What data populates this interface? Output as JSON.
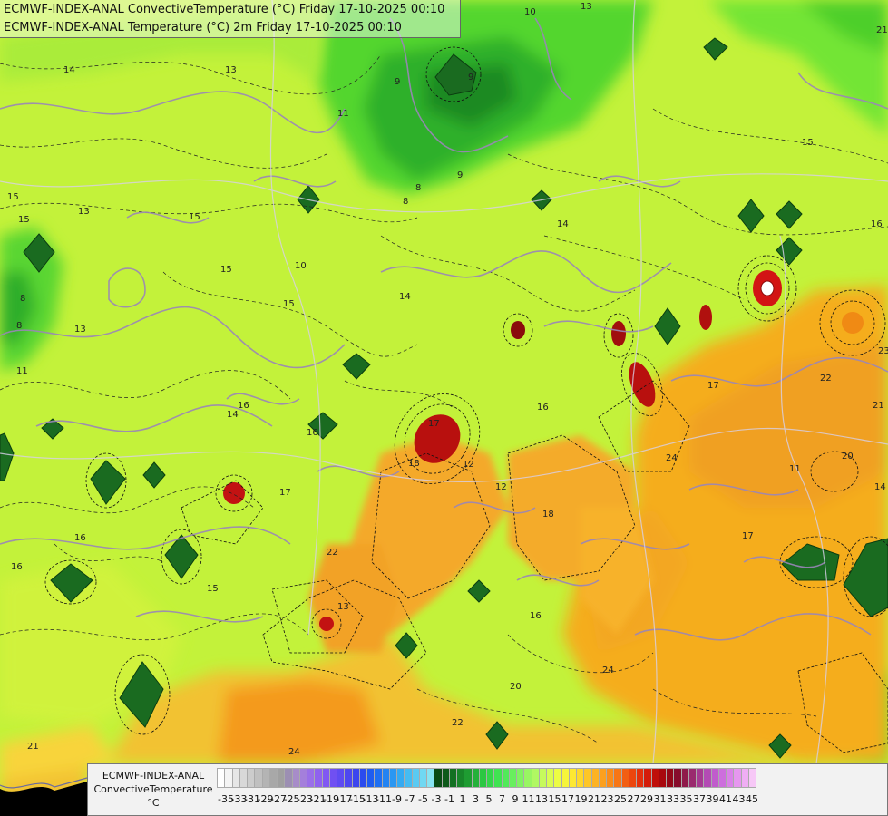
{
  "header": {
    "line1": "ECMWF-INDEX-ANAL ConvectiveTemperature (°C) Friday 17-10-2025 00:10",
    "line2": "ECMWF-INDEX-ANAL Temperature (°C) 2m Friday 17-10-2025 00:10"
  },
  "legend": {
    "model": "ECMWF-INDEX-ANAL",
    "variable": "ConvectiveTemperature",
    "unit": "°C",
    "tick_labels": [
      "-35",
      "-33",
      "-31",
      "-29",
      "-27",
      "-25",
      "-23",
      "-21",
      "-19",
      "-17",
      "-15",
      "-13",
      "-11",
      "-9",
      "-7",
      "-5",
      "-3",
      "-1",
      "1",
      "3",
      "5",
      "7",
      "9",
      "11",
      "13",
      "15",
      "17",
      "19",
      "21",
      "23",
      "25",
      "27",
      "29",
      "31",
      "33",
      "35",
      "37",
      "39",
      "41",
      "43",
      "45"
    ],
    "colors": [
      "#ffffff",
      "#f4f4f4",
      "#e6e6e6",
      "#d8d8d8",
      "#cccccc",
      "#c0c0c0",
      "#b4b4b4",
      "#a8a8a8",
      "#a0a0a0",
      "#9c8fb3",
      "#a78cc9",
      "#a47fdb",
      "#9a6fe8",
      "#8f62ef",
      "#8058f2",
      "#7050f2",
      "#5f4bf2",
      "#4e47f0",
      "#3c45ee",
      "#2b4bee",
      "#1f5cf0",
      "#1f6ff2",
      "#2383f2",
      "#2a97f2",
      "#34aaf2",
      "#45bcf2",
      "#5acaf2",
      "#70d8f2",
      "#88e4f2",
      "#0a4b14",
      "#0e5a1a",
      "#137022",
      "#18862a",
      "#1e9c32",
      "#24b13a",
      "#2bc742",
      "#34d64a",
      "#40e352",
      "#52ea5a",
      "#68ef5e",
      "#80f262",
      "#99f562",
      "#b0f862",
      "#c6fa5c",
      "#dafc52",
      "#ecfc44",
      "#f6f53a",
      "#fde832",
      "#fed82c",
      "#fec627",
      "#fdb322",
      "#fca01e",
      "#fa8c1a",
      "#f77616",
      "#f25e12",
      "#ec460e",
      "#e4300c",
      "#d41c0a",
      "#bf0f0a",
      "#a8080e",
      "#930818",
      "#870c2c",
      "#8f1a4a",
      "#9a2a6e",
      "#a63a92",
      "#b34bb4",
      "#c05ccc",
      "#cd6edd",
      "#da82e8",
      "#e697ef",
      "#f0aef4",
      "#f7c8f7"
    ]
  },
  "map": {
    "contour_labels": [
      "14",
      "13",
      "15",
      "11",
      "9",
      "8",
      "8",
      "10",
      "16",
      "15",
      "15",
      "15",
      "10",
      "14",
      "15",
      "16",
      "17",
      "23",
      "21",
      "22",
      "20",
      "14",
      "16",
      "17",
      "13",
      "16",
      "15",
      "15",
      "16",
      "20",
      "22",
      "24",
      "24",
      "24",
      "21",
      "21",
      "13",
      "8",
      "11",
      "8",
      "9",
      "17",
      "18",
      "12",
      "14",
      "13",
      "16",
      "9",
      "13",
      "14",
      "16",
      "18",
      "22",
      "12",
      "17",
      "11"
    ]
  }
}
